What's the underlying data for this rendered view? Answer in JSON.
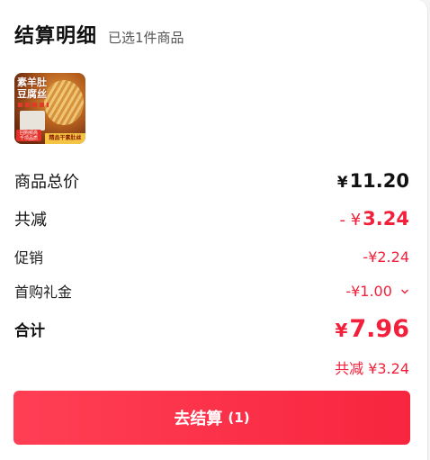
{
  "header": {
    "title": "结算明细",
    "selected_text": "已选1件商品"
  },
  "product": {
    "thumb_title": "素羊肚豆腐丝",
    "thumb_badge": "回购频高 千项品质",
    "thumb_banner": "精品干素肚丝"
  },
  "summary": {
    "total_label": "商品总价",
    "total_currency": "¥",
    "total_value": "11.20",
    "reduction_label": "共减",
    "reduction_prefix": "- ¥",
    "reduction_value": "3.24",
    "promo_label": "促销",
    "promo_value": "-¥2.24",
    "gift_label": "首购礼金",
    "gift_value": "-¥1.00",
    "sum_label": "合计",
    "sum_currency": "¥",
    "sum_value": "7.96",
    "saved_label": "共减",
    "saved_value": "¥3.24"
  },
  "checkout": {
    "label": "去结算",
    "count": "(1)"
  },
  "colors": {
    "accent": "#f2203a",
    "button": "#ff3f55"
  },
  "icons": {
    "gift_expand": "chevron-down-icon"
  }
}
